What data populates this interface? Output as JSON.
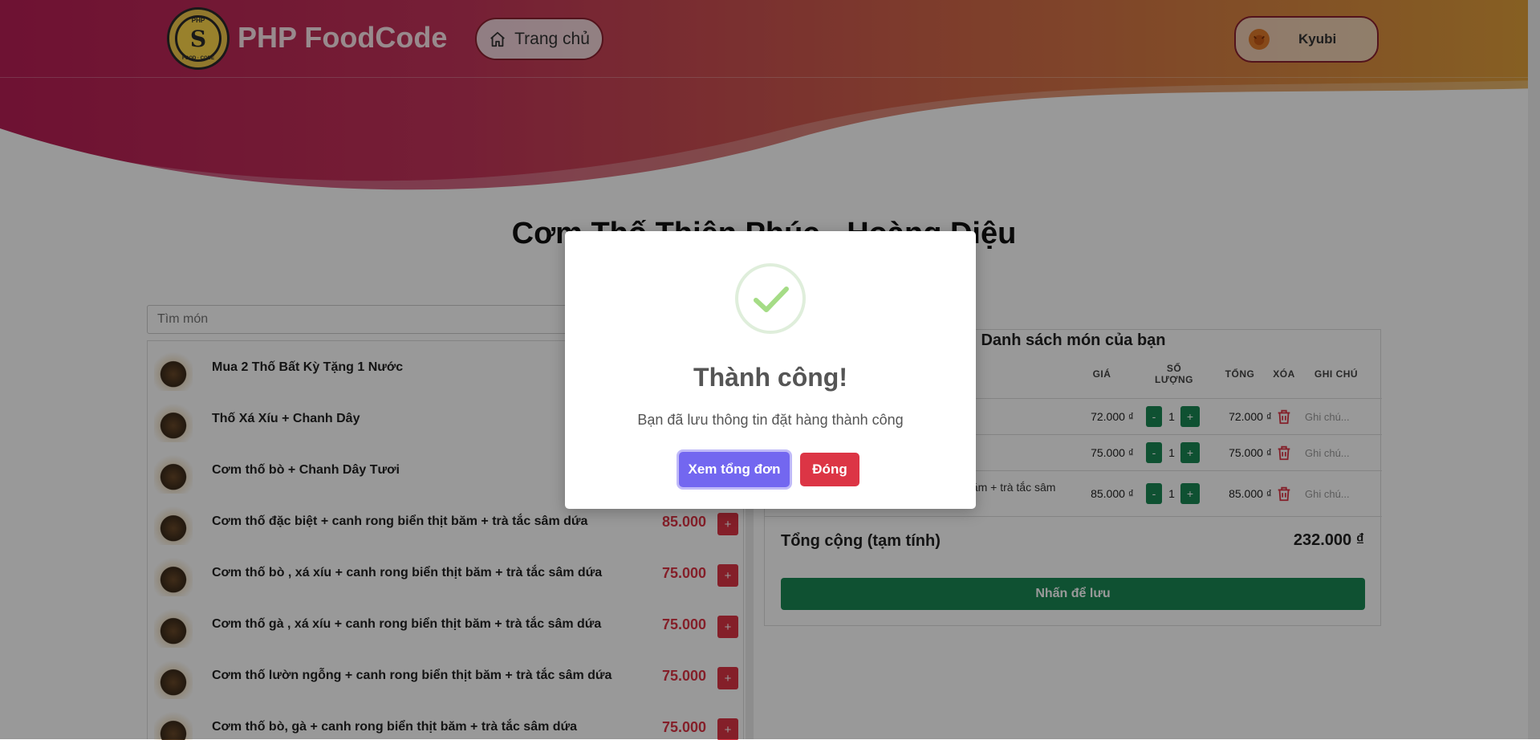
{
  "header": {
    "brand": "PHP FoodCode",
    "logo_mark": "S",
    "logo_top_text": "PHP",
    "logo_bottom_text": "FOOD · CODE",
    "home_label": "Trang chủ",
    "user_name": "Kyubi",
    "colors": {
      "gradient_start": "#b81e55",
      "gradient_end": "#e0a03a"
    }
  },
  "restaurant": {
    "title": "Cơm Thố Thiện Phúc - Hoàng Diệu"
  },
  "menu": {
    "search_placeholder": "Tìm món",
    "items": [
      {
        "name": "Mua 2 Thố Bất Kỳ Tặng 1 Nước",
        "price": "",
        "add": ""
      },
      {
        "name": "Thố Xá Xíu + Chanh Dây",
        "price": "",
        "add": ""
      },
      {
        "name": "Cơm thố bò + Chanh Dây Tươi",
        "price": "",
        "add": ""
      },
      {
        "name": "Cơm thố đặc biệt + canh rong biển thịt băm + trà tắc sâm dứa",
        "price": "85.000",
        "add": "+"
      },
      {
        "name": "Cơm thố bò , xá xíu + canh rong biển thịt băm + trà tắc sâm dứa",
        "price": "75.000",
        "add": "+"
      },
      {
        "name": "Cơm thố gà , xá xíu + canh rong biển thịt băm + trà tắc sâm dứa",
        "price": "75.000",
        "add": "+"
      },
      {
        "name": "Cơm thố lườn ngỗng + canh rong biển thịt băm + trà tắc sâm dứa",
        "price": "75.000",
        "add": "+"
      },
      {
        "name": "Cơm thố bò, gà + canh rong biển thịt băm + trà tắc sâm dứa",
        "price": "75.000",
        "add": "+"
      }
    ]
  },
  "cart": {
    "title": "Danh sách món của bạn",
    "columns": {
      "price": "GIÁ",
      "qty_line1": "SỐ",
      "qty_line2": "LƯỢNG",
      "total": "TỔNG",
      "delete": "XÓA",
      "note": "GHI CHÚ"
    },
    "rows": [
      {
        "name": "",
        "price": "72.000 ₫",
        "minus": "-",
        "qty": "1",
        "plus": "+",
        "total": "72.000 ₫",
        "note_placeholder": "Ghi chú..."
      },
      {
        "name": "",
        "price": "75.000 ₫",
        "minus": "-",
        "qty": "1",
        "plus": "+",
        "total": "75.000 ₫",
        "note_placeholder": "Ghi chú..."
      },
      {
        "name": "băm + trà tắc sâm",
        "price": "85.000 ₫",
        "minus": "-",
        "qty": "1",
        "plus": "+",
        "total": "85.000 ₫",
        "note_placeholder": "Ghi chú..."
      }
    ],
    "total_label": "Tổng cộng (tạm tính)",
    "total_value": "232.000 ₫",
    "save_label": "Nhấn để lưu"
  },
  "modal": {
    "icon": "success-check-icon",
    "title": "Thành công!",
    "message": "Bạn đã lưu thông tin đặt hàng thành công",
    "view_label": "Xem tổng đơn",
    "close_label": "Đóng",
    "colors": {
      "view": "#7367f0",
      "close": "#dc3545",
      "check": "#a5dc86"
    }
  }
}
